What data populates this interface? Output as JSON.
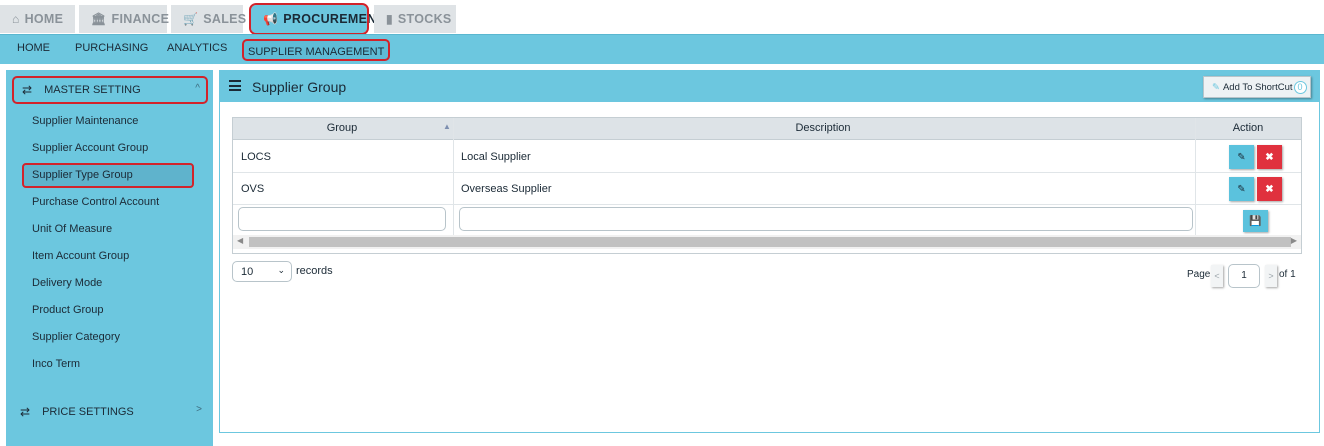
{
  "top_tabs": [
    {
      "label": "HOME",
      "icon": "home-icon"
    },
    {
      "label": "FINANCE",
      "icon": "bank-icon"
    },
    {
      "label": "SALES",
      "icon": "cart-icon"
    },
    {
      "label": "PROCUREMENT",
      "icon": "megaphone-icon"
    },
    {
      "label": "STOCKS",
      "icon": "bar-chart-icon"
    }
  ],
  "sub_nav": [
    "HOME",
    "PURCHASING",
    "ANALYTICS",
    "SUPPLIER MANAGEMENT"
  ],
  "sidebar": {
    "master_setting": "MASTER SETTING",
    "items": [
      "Supplier Maintenance",
      "Supplier Account Group",
      "Supplier Type Group",
      "Purchase Control Account",
      "Unit Of Measure",
      "Item Account Group",
      "Delivery Mode",
      "Product Group",
      "Supplier Category",
      "Inco Term"
    ],
    "price_settings": "PRICE SETTINGS"
  },
  "panel": {
    "title": "Supplier Group",
    "shortcut_label": "Add To ShortCut",
    "shortcut_count": "0"
  },
  "grid": {
    "columns": [
      "Group",
      "Description",
      "Action"
    ],
    "rows": [
      {
        "group": "LOCS",
        "description": "Local Supplier"
      },
      {
        "group": "OVS",
        "description": "Overseas Supplier"
      }
    ]
  },
  "footer": {
    "page_size": "10",
    "records_label": "records",
    "page_label": "Page",
    "page_value": "1",
    "of_label": "of 1"
  },
  "colors": {
    "accent": "#6cc7df",
    "highlight": "#d2232a",
    "delete": "#e0313e"
  }
}
